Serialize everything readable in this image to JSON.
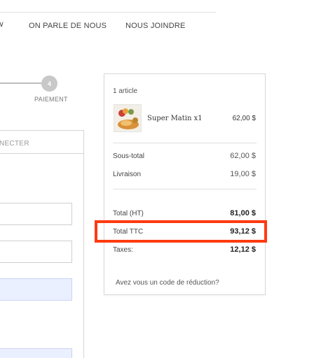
{
  "nav": {
    "chevron": "∨",
    "items": [
      "ON PARLE DE NOUS",
      "NOUS JOINDRE"
    ]
  },
  "steps": {
    "number": "4",
    "label": "PAIEMENT"
  },
  "left_panel": {
    "header_text": "NECTER"
  },
  "summary": {
    "item_count": "1 article",
    "product": {
      "name": "Super Matin x1",
      "price": "62,00 $"
    },
    "subtotal": {
      "label": "Sous-total",
      "value": "62,00 $"
    },
    "shipping": {
      "label": "Livraison",
      "value": "19,00 $"
    },
    "total_ht": {
      "label": "Total (HT)",
      "value": "81,00 $"
    },
    "total_ttc": {
      "label": "Total TTC",
      "value": "93,12 $"
    },
    "taxes": {
      "label": "Taxes:",
      "value": "12,12 $"
    },
    "promo_link": "Avez vous un code de réduction?"
  },
  "colors": {
    "highlight": "#ff3a10",
    "step_circle": "#c8c8c8",
    "field_blue": "#eaf0ff"
  }
}
